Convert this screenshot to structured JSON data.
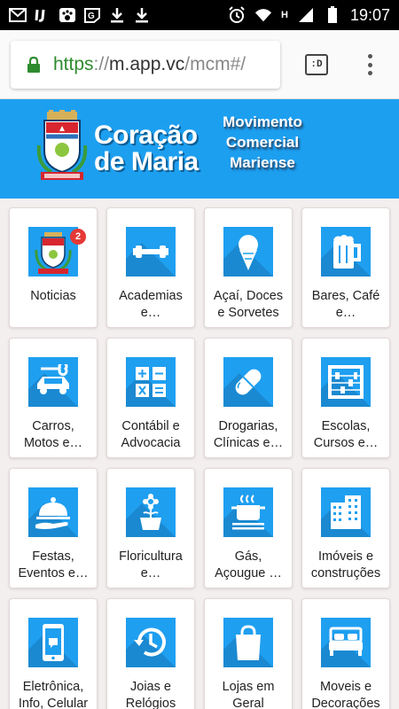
{
  "status_bar": {
    "time": "19:07",
    "network_letter": "H",
    "icons": [
      "mail-icon",
      "ij-icon",
      "paw-icon",
      "g-icon",
      "download-icon",
      "download-icon",
      "alarm-icon",
      "wifi-icon",
      "signal-icon",
      "battery-icon"
    ]
  },
  "browser": {
    "url_scheme": "https",
    "url_sep": "://",
    "url_host": "m.app.vc",
    "url_path": "/mcm#/",
    "tab_label": ":D"
  },
  "banner": {
    "brand_line1": "Coração",
    "brand_line2": "de Maria",
    "movement_line1": "Movimento",
    "movement_line2": "Comercial",
    "movement_line3": "Mariense",
    "background": "#1d9ff0"
  },
  "categories": [
    {
      "label": "Noticias",
      "icon": "crest-icon",
      "badge": "2"
    },
    {
      "label": "Academias e…",
      "icon": "dumbbell-icon"
    },
    {
      "label": "Açaí, Doces e Sorvetes",
      "icon": "ice-cream-icon"
    },
    {
      "label": "Bares, Café e…",
      "icon": "beer-mug-icon"
    },
    {
      "label": "Carros, Motos e…",
      "icon": "car-wrench-icon"
    },
    {
      "label": "Contábil e Advocacia",
      "icon": "calculator-icon"
    },
    {
      "label": "Drogarias, Clínicas e…",
      "icon": "pill-icon"
    },
    {
      "label": "Escolas, Cursos e…",
      "icon": "abacus-icon"
    },
    {
      "label": "Festas, Eventos e…",
      "icon": "cloche-icon"
    },
    {
      "label": "Floricultura e…",
      "icon": "flower-pot-icon"
    },
    {
      "label": "Gás, Açougue …",
      "icon": "cooking-pot-icon"
    },
    {
      "label": "Imóveis e construções",
      "icon": "building-icon"
    },
    {
      "label": "Eletrônica, Info, Celular",
      "icon": "smartphone-icon"
    },
    {
      "label": "Joias e Relógios",
      "icon": "clock-history-icon"
    },
    {
      "label": "Lojas em Geral",
      "icon": "shopping-bag-icon"
    },
    {
      "label": "Moveis e Decorações",
      "icon": "bed-icon"
    }
  ],
  "colors": {
    "accent": "#1f9ff0",
    "badge": "#e53935",
    "url_scheme": "#2e8b2e"
  }
}
